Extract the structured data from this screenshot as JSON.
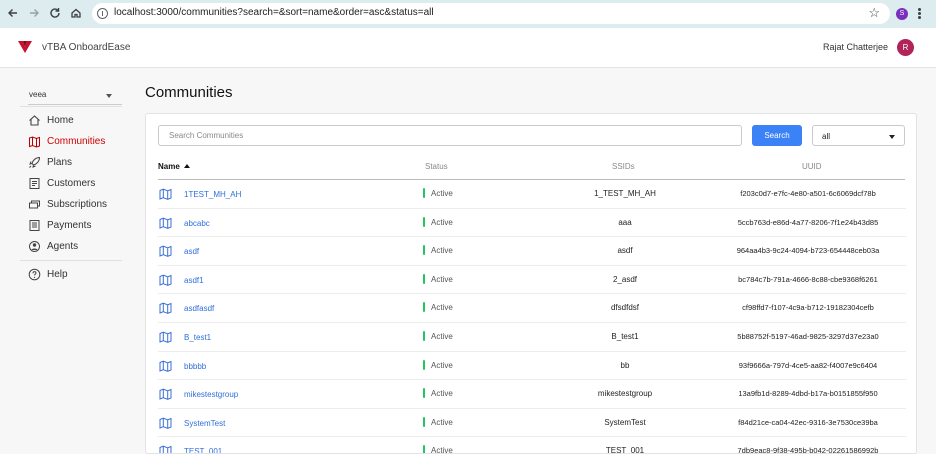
{
  "browser": {
    "url": "localhost:3000/communities?search=&sort=name&order=asc&status=all",
    "profile_initial": "S"
  },
  "header": {
    "brand": "vTBA OnboardEase",
    "user_name": "Rajat Chatterjee",
    "avatar_initial": "R",
    "brand_color": "#c8102e"
  },
  "sidebar": {
    "org": "veea",
    "items": [
      {
        "label": "Home",
        "icon": "home-icon"
      },
      {
        "label": "Communities",
        "icon": "map-icon",
        "active": true
      },
      {
        "label": "Plans",
        "icon": "rocket-icon"
      },
      {
        "label": "Customers",
        "icon": "list-icon"
      },
      {
        "label": "Subscriptions",
        "icon": "stack-icon"
      },
      {
        "label": "Payments",
        "icon": "payment-icon"
      },
      {
        "label": "Agents",
        "icon": "agent-icon"
      }
    ],
    "help_label": "Help"
  },
  "main": {
    "title": "Communities",
    "search_placeholder": "Search Communities",
    "search_button": "Search",
    "status_filter": "all",
    "columns": {
      "name": "Name",
      "status": "Status",
      "ssids": "SSIDs",
      "uuid": "UUID"
    },
    "rows": [
      {
        "name": "1TEST_MH_AH",
        "status": "Active",
        "ssids": "1_TEST_MH_AH",
        "uuid": "f203c0d7-e7fc-4e80-a501-6c6069dcf78b"
      },
      {
        "name": "abcabc",
        "status": "Active",
        "ssids": "aaa",
        "uuid": "5ccb763d-e86d-4a77-8206-7f1e24b43d85"
      },
      {
        "name": "asdf",
        "status": "Active",
        "ssids": "asdf",
        "uuid": "964aa4b3-9c24-4094-b723-654448ceb03a"
      },
      {
        "name": "asdf1",
        "status": "Active",
        "ssids": "2_asdf",
        "uuid": "bc784c7b-791a-4666-8c88-cbe9368f6261"
      },
      {
        "name": "asdfasdf",
        "status": "Active",
        "ssids": "dfsdfdsf",
        "uuid": "cf98ffd7-f107-4c9a-b712-19182304cefb"
      },
      {
        "name": "B_test1",
        "status": "Active",
        "ssids": "B_test1",
        "uuid": "5b88752f-5197-46ad-9825-3297d37e23a0"
      },
      {
        "name": "bbbbb",
        "status": "Active",
        "ssids": "bb",
        "uuid": "93f9666a-797d-4ce5-aa82-f4007e9c6404"
      },
      {
        "name": "mikestestgroup",
        "status": "Active",
        "ssids": "mikestestgroup",
        "uuid": "13a9fb1d-8289-4dbd-b17a-b0151855f950"
      },
      {
        "name": "SystemTest",
        "status": "Active",
        "ssids": "SystemTest",
        "uuid": "f84d21ce-ca04-42ec-9316-3e7530ce39ba"
      },
      {
        "name": "TEST_001",
        "status": "Active",
        "ssids": "TEST_001",
        "uuid": "7db9eac8-9f38-495b-b042-02261586992b"
      }
    ]
  }
}
